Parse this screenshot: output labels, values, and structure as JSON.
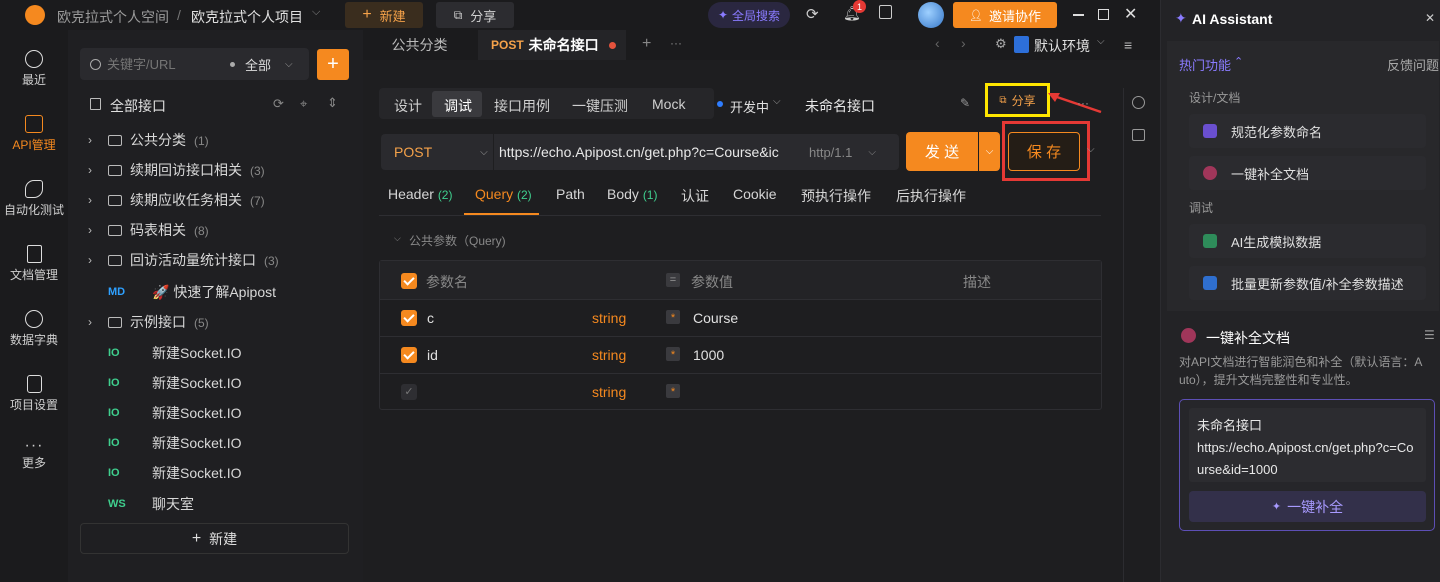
{
  "topbar": {
    "workspace": "欧克拉式个人空间",
    "separator": "/",
    "project": "欧克拉式个人项目",
    "new_label": "新建",
    "share_label": "分享",
    "global_search": "全局搜索",
    "notification_count": "1",
    "invite_label": "邀请协作"
  },
  "rail": [
    {
      "label": "最近",
      "icon": "clock-icon"
    },
    {
      "label": "API管理",
      "icon": "api-icon",
      "active": true
    },
    {
      "label": "自动化测试",
      "icon": "automation-icon"
    },
    {
      "label": "文档管理",
      "icon": "document-icon"
    },
    {
      "label": "数据字典",
      "icon": "dictionary-icon"
    },
    {
      "label": "项目设置",
      "icon": "settings-icon"
    },
    {
      "label": "更多",
      "icon": "more-icon"
    }
  ],
  "tree": {
    "search_placeholder": "关键字/URL",
    "filter_label": "全部",
    "all_label": "全部接口",
    "items": [
      {
        "type": "folder",
        "label": "公共分类",
        "count": "(1)"
      },
      {
        "type": "folder",
        "label": "续期回访接口相关",
        "count": "(3)"
      },
      {
        "type": "folder",
        "label": "续期应收任务相关",
        "count": "(7)"
      },
      {
        "type": "folder",
        "label": "码表相关",
        "count": "(8)"
      },
      {
        "type": "folder",
        "label": "回访活动量统计接口",
        "count": "(3)"
      },
      {
        "type": "doc",
        "tag": "MD",
        "label": "🚀 快速了解Apipost"
      },
      {
        "type": "folder",
        "label": "示例接口",
        "count": "(5)"
      },
      {
        "type": "api",
        "tag": "IO",
        "label": "新建Socket.IO"
      },
      {
        "type": "api",
        "tag": "IO",
        "label": "新建Socket.IO"
      },
      {
        "type": "api",
        "tag": "IO",
        "label": "新建Socket.IO"
      },
      {
        "type": "api",
        "tag": "IO",
        "label": "新建Socket.IO"
      },
      {
        "type": "api",
        "tag": "IO",
        "label": "新建Socket.IO"
      },
      {
        "type": "api",
        "tag": "WS",
        "label": "聊天室"
      }
    ],
    "new_label": "新建"
  },
  "tabs": {
    "tab1": "公共分类",
    "tab2_method": "POST",
    "tab2_label": "未命名接口",
    "env_label": "默认环境"
  },
  "request": {
    "modes": [
      "设计",
      "调试",
      "接口用例",
      "一键压测",
      "Mock"
    ],
    "active_mode": "调试",
    "status": "开发中",
    "name": "未命名接口",
    "share_label": "分享",
    "method": "POST",
    "url": "https://echo.Apipost.cn/get.php?c=Course&ic",
    "protocol": "http/1.1",
    "send_label": "发 送",
    "save_label": "保 存",
    "param_tabs": [
      {
        "label": "Header",
        "count": "(2)"
      },
      {
        "label": "Query",
        "count": "(2)"
      },
      {
        "label": "Path",
        "count": ""
      },
      {
        "label": "Body",
        "count": "(1)"
      },
      {
        "label": "认证",
        "count": ""
      },
      {
        "label": "Cookie",
        "count": ""
      },
      {
        "label": "预执行操作",
        "count": ""
      },
      {
        "label": "后执行操作",
        "count": ""
      }
    ],
    "section_label": "公共参数（Query)",
    "columns": {
      "name": "参数名",
      "value": "参数值",
      "desc": "描述"
    },
    "rows": [
      {
        "name": "c",
        "type": "string",
        "value": "Course"
      },
      {
        "name": "id",
        "type": "string",
        "value": "1000"
      },
      {
        "name": "",
        "type": "string",
        "value": ""
      }
    ]
  },
  "ai": {
    "title": "AI Assistant",
    "hot_label": "热门功能",
    "feedback_label": "反馈问题",
    "group1": "设计/文档",
    "item1": "规范化参数命名",
    "item2": "一键补全文档",
    "group2": "调试",
    "item3": "AI生成模拟数据",
    "item4": "批量更新参数值/补全参数描述",
    "feature_title": "一键补全文档",
    "feature_desc": "对API文档进行智能润色和补全（默认语言：Auto），提升文档完整性和专业性。",
    "card_name": "未命名接口",
    "card_url": "https://echo.Apipost.cn/get.php?c=Course&id=1000",
    "action_label": "一键补全"
  },
  "colors": {
    "accent": "#f5891f",
    "purple": "#8a7bff",
    "highlight_yellow": "#ffe600",
    "highlight_red": "#e53935"
  }
}
